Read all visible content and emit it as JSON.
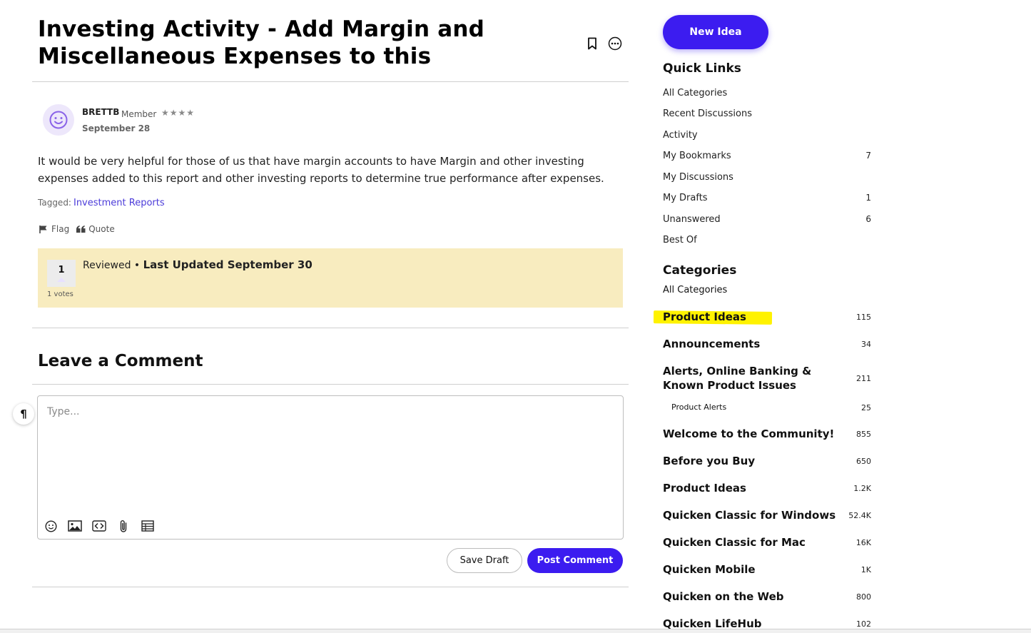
{
  "post": {
    "title": "Investing Activity - Add Margin and Miscellaneous Expenses to this",
    "author": "BRETTB",
    "role": "Member",
    "rank_stars": "★★★★",
    "date": "September 28",
    "body": "It would be very helpful for those of us that have margin accounts to have Margin and other investing expenses added to this report and other investing reports to determine true performance after expenses.",
    "tagged_label": "Tagged:",
    "tag": "Investment Reports",
    "actions": {
      "flag": "Flag",
      "quote": "Quote"
    },
    "status": {
      "votes": "1",
      "votes_label": "1 votes",
      "reviewed": "Reviewed",
      "separator": "•",
      "last_updated": "Last Updated September 30"
    }
  },
  "comment": {
    "heading": "Leave a Comment",
    "placeholder": "Type...",
    "save_draft": "Save Draft",
    "post": "Post Comment",
    "pilcrow": "¶"
  },
  "sidebar": {
    "new_idea": "New Idea",
    "quick_links_heading": "Quick Links",
    "quick_links": [
      {
        "label": "All Categories",
        "count": ""
      },
      {
        "label": "Recent Discussions",
        "count": ""
      },
      {
        "label": "Activity",
        "count": ""
      },
      {
        "label": "My Bookmarks",
        "count": "7"
      },
      {
        "label": "My Discussions",
        "count": ""
      },
      {
        "label": "My Drafts",
        "count": "1"
      },
      {
        "label": "Unanswered",
        "count": "6"
      },
      {
        "label": "Best Of",
        "count": ""
      }
    ],
    "categories_heading": "Categories",
    "categories": [
      {
        "label": "All Categories",
        "count": ""
      },
      {
        "label": "Product Ideas",
        "count": "115"
      },
      {
        "label": "Announcements",
        "count": "34"
      },
      {
        "label": "Alerts, Online Banking & Known Product Issues",
        "count": "211"
      },
      {
        "label": "Product Alerts",
        "count": "25"
      },
      {
        "label": "Welcome to the Community!",
        "count": "855"
      },
      {
        "label": "Before you Buy",
        "count": "650"
      },
      {
        "label": "Product Ideas",
        "count": "1.2K"
      },
      {
        "label": "Quicken Classic for Windows",
        "count": "52.4K"
      },
      {
        "label": "Quicken Classic for Mac",
        "count": "16K"
      },
      {
        "label": "Quicken Mobile",
        "count": "1K"
      },
      {
        "label": "Quicken on the Web",
        "count": "800"
      },
      {
        "label": "Quicken LifeHub",
        "count": "102"
      }
    ]
  },
  "colors": {
    "accent": "#3c1cf0",
    "status_bg": "#f8ecbf",
    "highlight": "#fff200",
    "tag_link": "#4b3bd9"
  }
}
